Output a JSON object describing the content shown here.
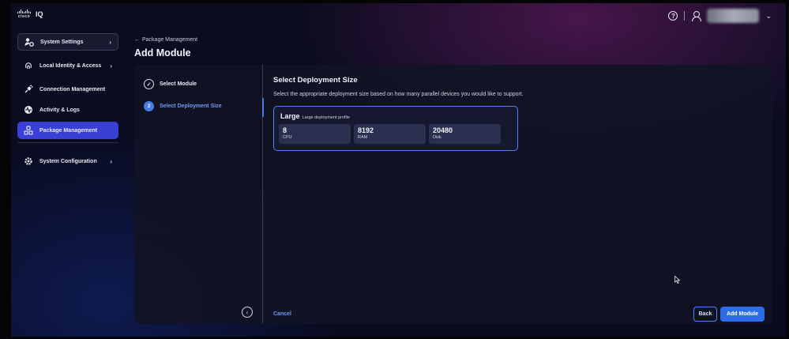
{
  "app": {
    "logo_text": "cisco",
    "product_name": "IQ"
  },
  "topbar": {
    "help_glyph": "?",
    "user_menu_chevron": "⌄"
  },
  "sidebar": {
    "items": [
      {
        "label": "System Settings",
        "icon": "gear-user-icon",
        "chevron": "›"
      },
      {
        "label": "Local Identity & Access",
        "icon": "fingerprint-icon",
        "chevron": "›"
      },
      {
        "label": "Connection Management",
        "icon": "plug-icon"
      },
      {
        "label": "Activity & Logs",
        "icon": "activity-icon"
      },
      {
        "label": "Package Management",
        "icon": "package-icon",
        "active": true
      },
      {
        "label": "System Configuration",
        "icon": "settings-icon",
        "chevron": "›"
      }
    ]
  },
  "header": {
    "back_arrow": "←",
    "back_label": "Package Management",
    "title": "Add Module"
  },
  "wizard": {
    "steps": [
      {
        "label": "Select Module",
        "state": "complete",
        "glyph": "✓"
      },
      {
        "label": "Select Deployment Size",
        "state": "active",
        "number": "2"
      }
    ],
    "collapse_glyph": "‹"
  },
  "deployment": {
    "title": "Select Deployment Size",
    "description": "Select the appropriate deployment size based on how many parallel devices you would like to support.",
    "profile": {
      "name": "Large",
      "description": "Large deployment profile",
      "metrics": [
        {
          "value": "8",
          "label": "CPU"
        },
        {
          "value": "8192",
          "label": "RAM"
        },
        {
          "value": "20480",
          "label": "Disk"
        }
      ]
    }
  },
  "actions": {
    "cancel": "Cancel",
    "back": "Back",
    "add": "Add Module"
  },
  "colors": {
    "accent": "#2e6be6",
    "active_nav": "#3a3fd6",
    "link": "#6d9af4"
  }
}
